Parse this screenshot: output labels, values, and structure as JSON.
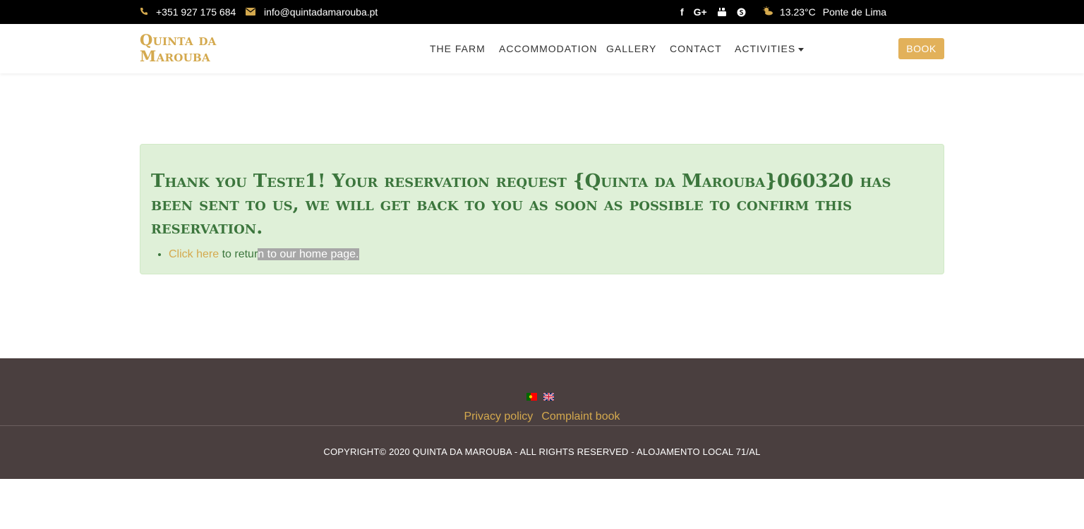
{
  "topbar": {
    "phone": "+351 927 175 684",
    "email": "info@quintadamarouba.pt",
    "social": [
      "facebook-icon",
      "google-plus-icon",
      "youtube-icon",
      "skype-icon"
    ],
    "social_labels": {
      "facebook": "f",
      "google": "G+"
    },
    "weather": {
      "temperature": "13.23°C",
      "location": "Ponte de Lima",
      "icon": "partly-sunny-icon"
    }
  },
  "nav": {
    "logo_line1": "Quinta da",
    "logo_line2": "Marouba",
    "items": [
      "THE FARM",
      "ACCOMMODATION",
      "GALLERY",
      "CONTACT",
      "ACTIVITIES"
    ],
    "book_label": "BOOK"
  },
  "alert": {
    "message": "Thank you Teste1! Your reservation request {Quinta da Marouba}060320 has been sent to us, we will get back to you as soon as possible to confirm this reservation.",
    "link_text": "Click here",
    "link_suffix_plain": " to retur",
    "link_suffix_selected": "n to our home page."
  },
  "footer": {
    "languages": [
      "Português",
      "English"
    ],
    "privacy": "Privacy policy",
    "complaint": "Complaint book",
    "copyright": "COPYRIGHT© 2020 QUINTA DA MAROUBA - ALL RIGHTS RESERVED - ALOJAMENTO LOCAL 71/AL"
  },
  "colors": {
    "accent": "#d4a94e",
    "alert_bg": "#dff0d8",
    "alert_text": "#3c763d",
    "footer_bg": "#4a3f3f"
  }
}
